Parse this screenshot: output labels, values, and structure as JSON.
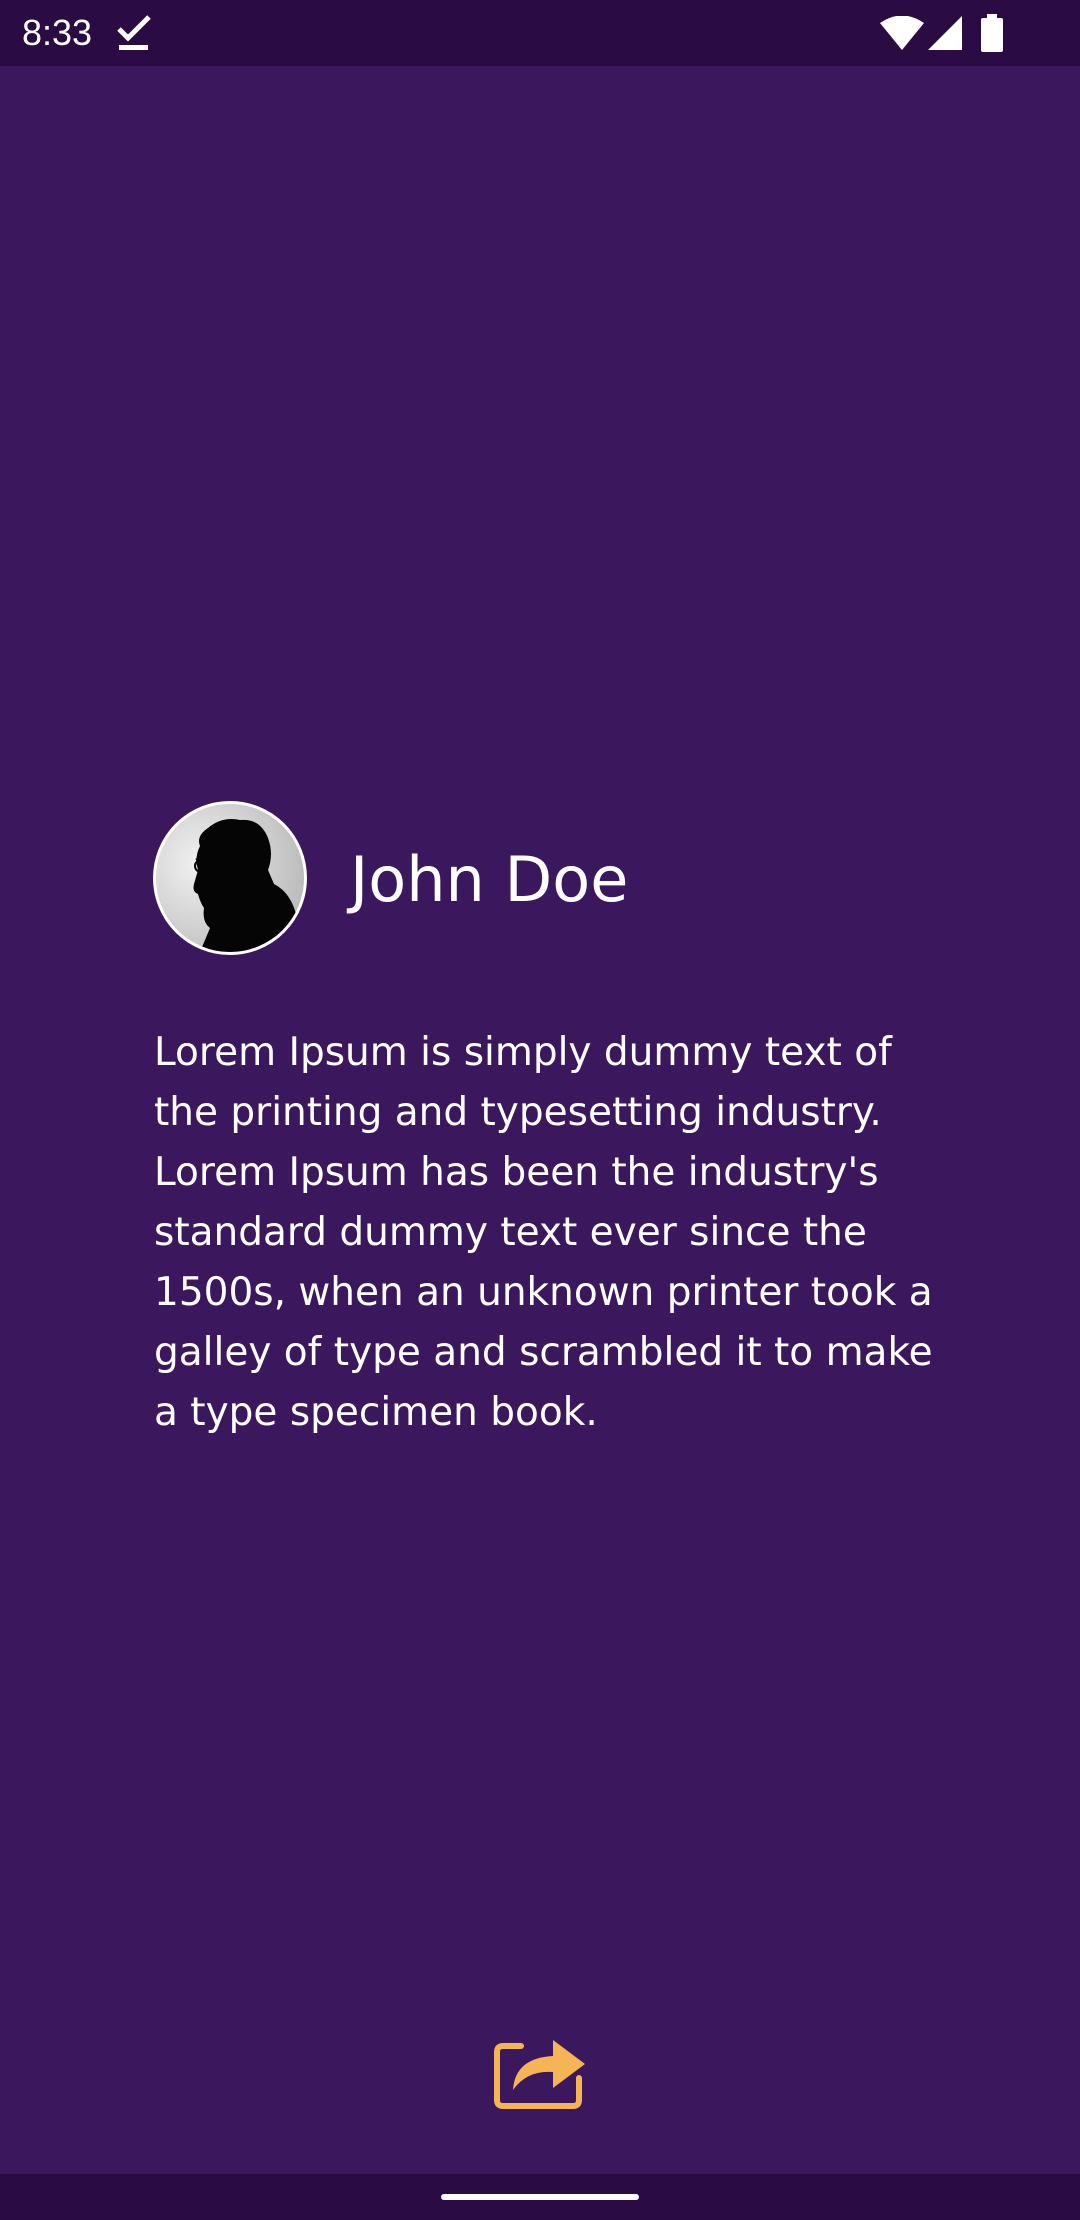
{
  "status_bar": {
    "time": "8:33",
    "icons": [
      "check-icon",
      "wifi-icon",
      "signal-icon",
      "battery-icon"
    ]
  },
  "profile": {
    "avatar_icon": "user-silhouette-avatar",
    "name": "John Doe",
    "bio": "Lorem Ipsum is simply dummy text of the printing and typesetting industry. Lorem Ipsum has been the industry's standard dummy text ever since the 1500s, when an unknown printer took a galley of type and scrambled it to make a type specimen book."
  },
  "actions": {
    "share_icon": "share-icon"
  },
  "colors": {
    "background": "#3b185d",
    "status_bar": "#2a0b44",
    "text": "#ffffff",
    "accent": "#f5b555"
  }
}
